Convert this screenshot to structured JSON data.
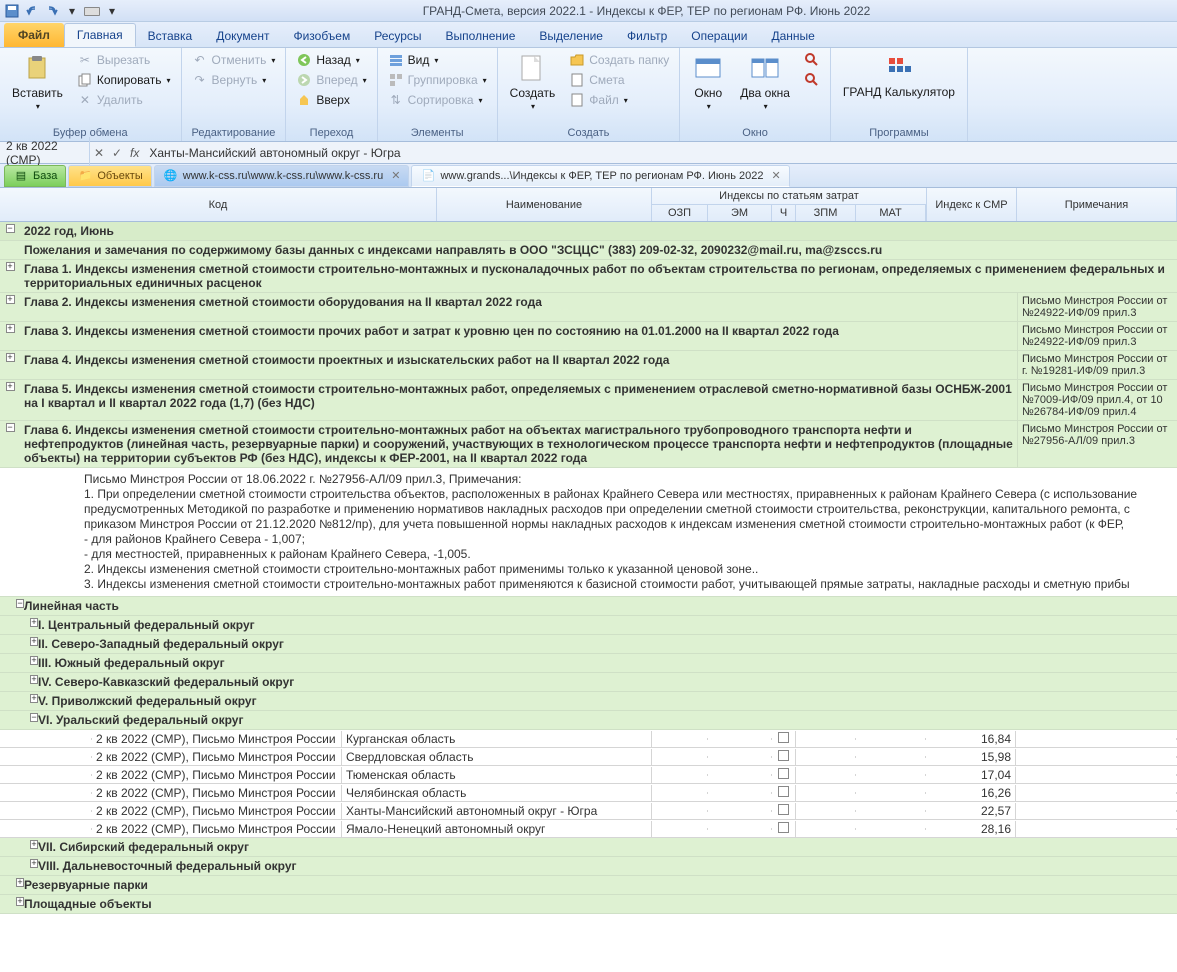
{
  "titlebar": {
    "title": "ГРАНД-Смета, версия 2022.1 - Индексы к ФЕР, ТЕР по регионам РФ. Июнь 2022"
  },
  "tabs": {
    "file": "Файл",
    "items": [
      "Главная",
      "Вставка",
      "Документ",
      "Физобъем",
      "Ресурсы",
      "Выполнение",
      "Выделение",
      "Фильтр",
      "Операции",
      "Данные"
    ],
    "active": 0
  },
  "ribbon": {
    "clipboard": {
      "label": "Буфер обмена",
      "paste": "Вставить",
      "cut": "Вырезать",
      "copy": "Копировать",
      "delete": "Удалить"
    },
    "editing": {
      "label": "Редактирование",
      "undo": "Отменить",
      "redo": "Вернуть",
      "back": "Назад",
      "forward": "Вперед",
      "up": "Вверх",
      "jump": "Переход"
    },
    "elements": {
      "label": "Элементы",
      "view": "Вид",
      "group": "Группировка",
      "sort": "Сортировка"
    },
    "create": {
      "label": "Создать",
      "create": "Создать",
      "folder": "Создать папку",
      "estimate": "Смета",
      "file": "Файл"
    },
    "window": {
      "label": "Окно",
      "window": "Окно",
      "two": "Два окна"
    },
    "programs": {
      "label": "Программы",
      "calc": "ГРАНД Калькулятор"
    }
  },
  "formulabar": {
    "ref": "2 кв 2022 (СМР)",
    "value": "Ханты-Мансийский автономный округ - Югра"
  },
  "doctabs": {
    "base": "База",
    "objects": "Объекты",
    "web": "www.k-css.ru\\www.k-css.ru\\www.k-css.ru",
    "active": "www.grands...\\Индексы к ФЕР, ТЕР по регионам РФ. Июнь 2022"
  },
  "headers": {
    "code": "Код",
    "name": "Наименование",
    "idx": "Индексы по статьям затрат",
    "smr": "Индекс к СМР",
    "note": "Примечания",
    "sub": {
      "ozp": "ОЗП",
      "em": "ЭМ",
      "ch": "Ч",
      "zpm": "ЗПМ",
      "mat": "МАТ"
    }
  },
  "tree": {
    "year": "2022 год, Июнь",
    "note_contact": "Пожелания и замечания по содержимому базы данных с индексами направлять в ООО \"ЗСЦЦС\" (383) 209-02-32, 2090232@mail.ru, ma@zsccs.ru",
    "ch1": "Глава 1. Индексы изменения сметной стоимости строительно-монтажных и пусконаладочных работ по объектам строительства по регионам, определяемых с применением федеральных и территориальных единичных расценок",
    "ch2": "Глава 2. Индексы изменения сметной стоимости оборудования на II квартал 2022 года",
    "ch2_note": "Письмо Минстроя России от №24922-ИФ/09 прил.3",
    "ch3": "Глава 3. Индексы изменения сметной стоимости прочих работ и затрат к уровню цен по состоянию на 01.01.2000 на II квартал 2022 года",
    "ch3_note": "Письмо Минстроя России от №24922-ИФ/09 прил.3",
    "ch4": "Глава 4. Индексы изменения сметной стоимости проектных и изыскательских работ на II квартал 2022 года",
    "ch4_note": "Письмо Минстроя России  от г. №19281-ИФ/09 прил.3",
    "ch5": "Глава 5. Индексы изменения сметной стоимости строительно-монтажных работ, определяемых с применением отраслевой сметно-нормативной базы ОСНБЖ-2001 на I квартал и II квартал 2022 года (1,7) (без НДС)",
    "ch5_note": "Письмо Минстроя России от №7009-ИФ/09 прил.4, от 10 №26784-ИФ/09 прил.4",
    "ch6": "Глава 6. Индексы изменения сметной стоимости строительно-монтажных работ на объектах магистрального трубопроводного транспорта нефти и нефтепродуктов (линейная часть, резервуарные парки) и сооружений, участвующих в технологическом процессе транспорта нефти и нефтепродуктов (площадные объекты) на территории субъектов РФ (без НДС), индексы к ФЕР-2001, на II квартал 2022 года",
    "ch6_note": "Письмо Минстроя России от №27956-АЛ/09 прил.3",
    "notes": [
      "Письмо Минстроя России от 18.06.2022 г. №27956-АЛ/09 прил.3, Примечания:",
      "1. При определении сметной стоимости строительства объектов, расположенных в районах Крайнего Севера или местностях, приравненных к районам Крайнего Севера (с использование предусмотренных Методикой по разработке и применению нормативов накладных расходов при определении сметной стоимости строительства, реконструкции, капитального ремонта, с приказом Минстроя России от 21.12.2020 №812/пр), для учета повышенной нормы накладных расходов к индексам изменения сметной стоимости строительно-монтажных работ (к ФЕР,",
      "- для районов Крайнего Севера - 1,007;",
      "- для местностей, приравненных к районам Крайнего Севера, -1,005.",
      "2. Индексы изменения сметной стоимости строительно-монтажных  работ применимы только к указанной ценовой зоне..",
      "3. Индексы изменения сметной стоимости строительно-монтажных  работ применяются к базисной стоимости работ, учитывающей прямые затраты, накладные расходы и сметную прибы"
    ],
    "linear": "Линейная часть",
    "fd": {
      "f1": "I. Центральный федеральный округ",
      "f2": "II. Северо-Западный федеральный округ",
      "f3": "III. Южный федеральный округ",
      "f4": "IV. Северо-Кавказский федеральный округ",
      "f5": "V. Приволжский федеральный округ",
      "f6": "VI. Уральский федеральный округ",
      "f7": "VII. Сибирский федеральный округ",
      "f8": "VIII. Дальневосточный федеральный округ"
    },
    "rows": [
      {
        "code": "2 кв 2022 (СМР), Письмо Минстроя России",
        "name": "Курганская область",
        "smr": "16,84"
      },
      {
        "code": "2 кв 2022 (СМР), Письмо Минстроя России",
        "name": "Свердловская область",
        "smr": "15,98"
      },
      {
        "code": "2 кв 2022 (СМР), Письмо Минстроя России",
        "name": "Тюменская область",
        "smr": "17,04"
      },
      {
        "code": "2 кв 2022 (СМР), Письмо Минстроя России",
        "name": "Челябинская область",
        "smr": "16,26"
      },
      {
        "code": "2 кв 2022 (СМР), Письмо Минстроя России",
        "name": "Ханты-Мансийский автономный округ - Югра",
        "smr": "22,57",
        "sel": true
      },
      {
        "code": "2 кв 2022 (СМР), Письмо Минстроя России",
        "name": "Ямало-Ненецкий  автономный округ",
        "smr": "28,16"
      }
    ],
    "reserv": "Резервуарные парки",
    "square": "Площадные объекты"
  }
}
